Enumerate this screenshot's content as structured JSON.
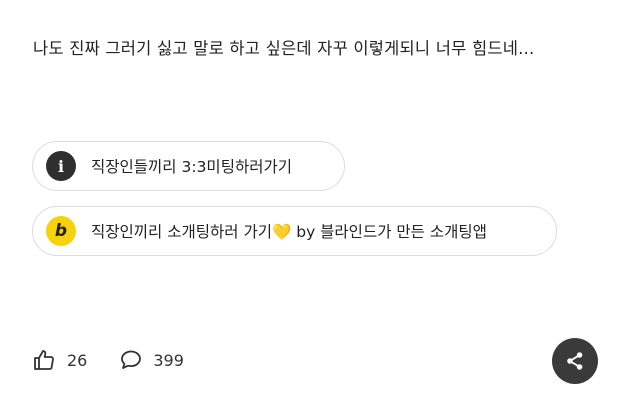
{
  "post": {
    "body": "나도 진짜 그러기 싫고 말로 하고 싶은데 자꾸 이렇게되니 너무 힘드네..."
  },
  "ads": [
    {
      "icon": "info-icon",
      "icon_char": "i",
      "label": "직장인들끼리 3:3미팅하러가기"
    },
    {
      "icon": "b-icon",
      "icon_char": "b",
      "label_before": "직장인끼리 소개팅하러 가기",
      "heart": "💛",
      "label_after": " by 블라인드가 만든 소개팅앱"
    }
  ],
  "actions": {
    "likes": "26",
    "comments": "399"
  },
  "colors": {
    "b_icon": "#f5d20c",
    "share_button": "#3a3a3a"
  }
}
